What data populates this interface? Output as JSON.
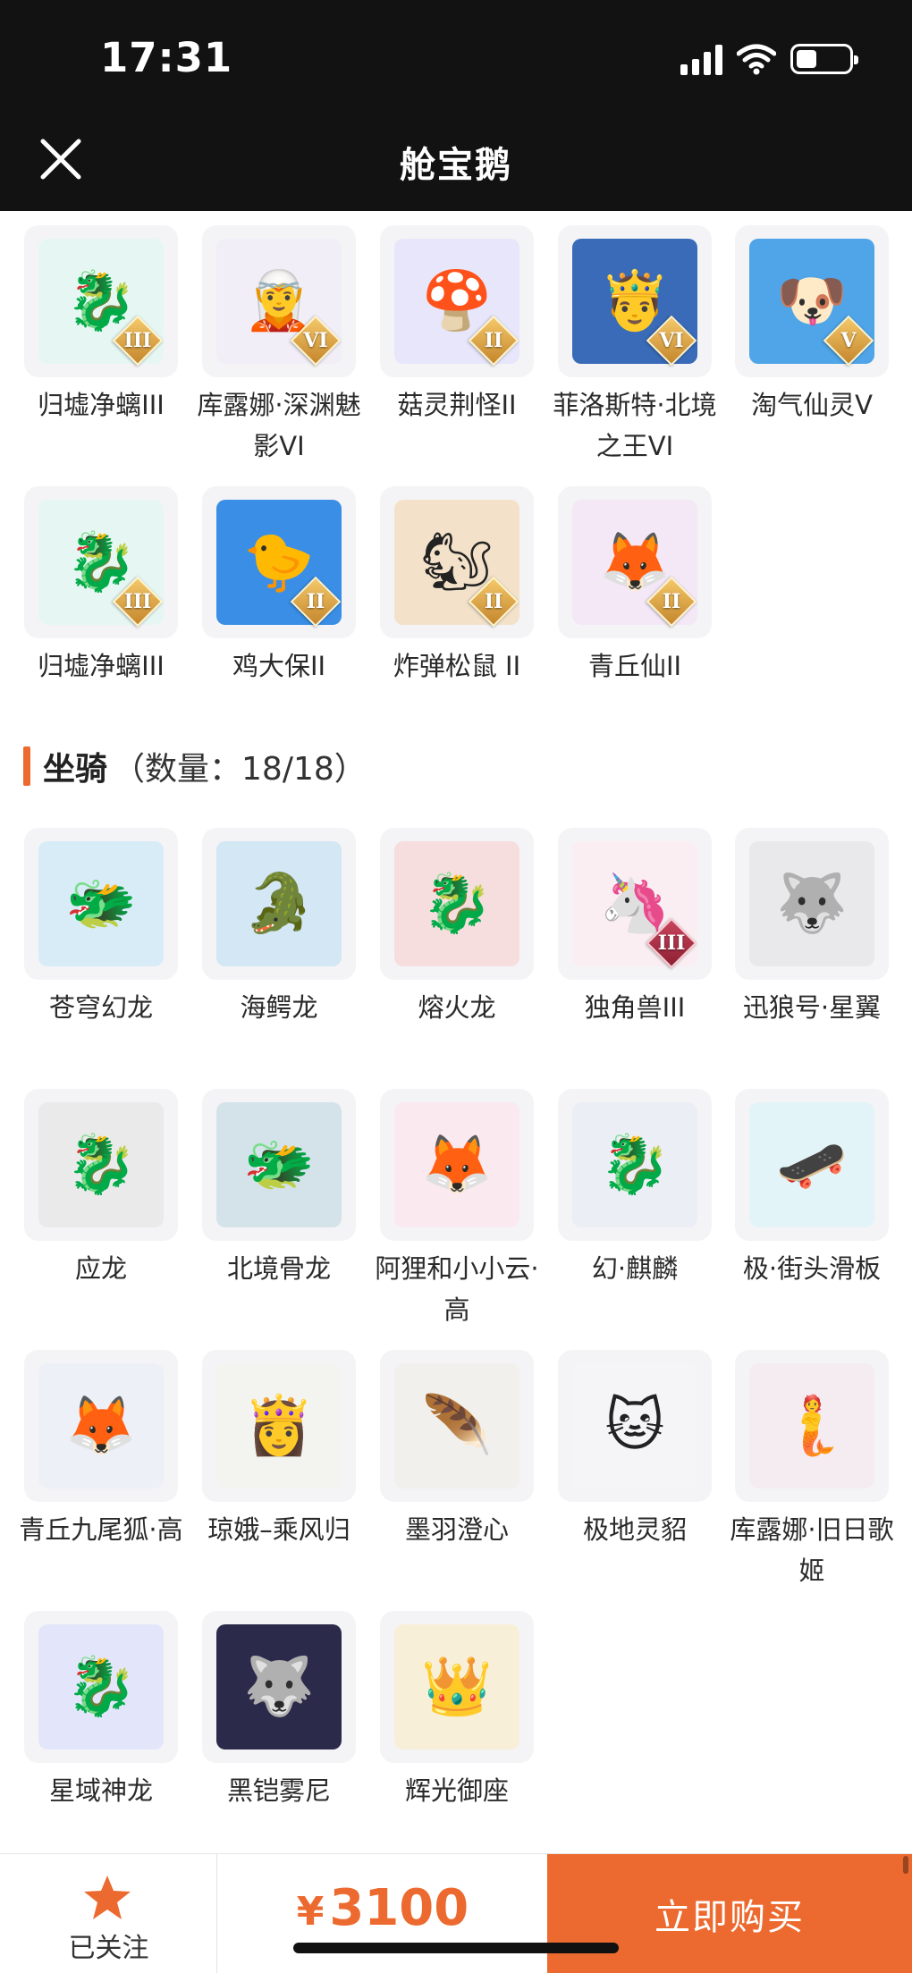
{
  "status_bar": {
    "time": "17:31"
  },
  "header": {
    "title": "舱宝鹅"
  },
  "top_grid": [
    {
      "label": "归墟净螭III",
      "tier": "III",
      "icon": "dragon-icon",
      "glyph": "🐉",
      "bg": "#e6f7f3"
    },
    {
      "label": "库露娜·深渊魅影VI",
      "tier": "VI",
      "icon": "character-icon",
      "glyph": "🧝",
      "bg": "#f1eef8"
    },
    {
      "label": "菇灵荆怪II",
      "tier": "II",
      "icon": "mushroom-creature-icon",
      "glyph": "🍄",
      "bg": "#e7e6fb"
    },
    {
      "label": "菲洛斯特·北境之王VI",
      "tier": "VI",
      "icon": "ice-king-icon",
      "glyph": "🤴",
      "bg": "#3a6bb8"
    },
    {
      "label": "淘气仙灵V",
      "tier": "V",
      "icon": "puppy-spirit-icon",
      "glyph": "🐶",
      "bg": "#4fa5e8"
    },
    {
      "label": "归墟净螭III",
      "tier": "III",
      "icon": "dragon-icon",
      "glyph": "🐉",
      "bg": "#e6f7f3"
    },
    {
      "label": "鸡大保II",
      "tier": "II",
      "icon": "chick-icon",
      "glyph": "🐤",
      "bg": "#3a8ee6"
    },
    {
      "label": "炸弹松鼠 II",
      "tier": "II",
      "icon": "squirrel-icon",
      "glyph": "🐿",
      "bg": "#f3e2c9"
    },
    {
      "label": "青丘仙II",
      "tier": "II",
      "icon": "fox-fairy-icon",
      "glyph": "🦊",
      "bg": "#f4e8f6"
    }
  ],
  "mounts": {
    "title": "坐骑",
    "count": "（数量：18/18）",
    "items": [
      {
        "label": "苍穹幻龙",
        "icon": "sky-dragon-icon",
        "glyph": "🐲",
        "bg": "#d8ecf8"
      },
      {
        "label": "海鳄龙",
        "icon": "sea-dragon-icon",
        "glyph": "🐊",
        "bg": "#d3e7f4"
      },
      {
        "label": "熔火龙",
        "icon": "fire-dragon-icon",
        "glyph": "🐉",
        "bg": "#f6dede"
      },
      {
        "label": "独角兽III",
        "icon": "unicorn-icon",
        "glyph": "🦄",
        "bg": "#fbeef2",
        "tier": "III",
        "red": true
      },
      {
        "label": "迅狼号·星翼",
        "icon": "mech-wolf-icon",
        "glyph": "🐺",
        "bg": "#e9e9ec"
      },
      {
        "label": "应龙",
        "icon": "winged-dragon-icon",
        "glyph": "🐉",
        "bg": "#eaeaea"
      },
      {
        "label": "北境骨龙",
        "icon": "bone-dragon-icon",
        "glyph": "🐲",
        "bg": "#d4e3ea"
      },
      {
        "label": "阿狸和小小云·高",
        "icon": "fox-and-cloud-icon",
        "glyph": "🦊",
        "bg": "#fbe9f0"
      },
      {
        "label": "幻·麒麟",
        "icon": "qilin-icon",
        "glyph": "🐉",
        "bg": "#eceef5"
      },
      {
        "label": "极·街头滑板",
        "icon": "skateboard-icon",
        "glyph": "🛹",
        "bg": "#e3f4f8"
      },
      {
        "label": "青丘九尾狐·高",
        "icon": "nine-tailed-fox-icon",
        "glyph": "🦊",
        "bg": "#eef0f8"
      },
      {
        "label": "琼娥–乘风归",
        "icon": "moon-maiden-icon",
        "glyph": "👸",
        "bg": "#f3f3ef"
      },
      {
        "label": "墨羽澄心",
        "icon": "winged-staff-icon",
        "glyph": "🪶",
        "bg": "#f2f0ec"
      },
      {
        "label": "极地灵貂",
        "icon": "polar-ferret-icon",
        "glyph": "🐱",
        "bg": "#f5f5f7"
      },
      {
        "label": "库露娜·旧日歌姬",
        "icon": "singer-icon",
        "glyph": "🧜",
        "bg": "#f4ecf1"
      },
      {
        "label": "星域神龙",
        "icon": "star-dragon-icon",
        "glyph": "🐉",
        "bg": "#e3e6fb"
      },
      {
        "label": "黑铠雾尼",
        "icon": "black-armor-beast-icon",
        "glyph": "🐺",
        "bg": "#2c2a4a"
      },
      {
        "label": "辉光御座",
        "icon": "golden-throne-icon",
        "glyph": "👑",
        "bg": "#f8efd8"
      }
    ]
  },
  "bottom_bar": {
    "follow_label": "已关注",
    "currency": "¥",
    "price": "3100",
    "buy_label": "立即购买",
    "accent": "#ec6a2f"
  }
}
